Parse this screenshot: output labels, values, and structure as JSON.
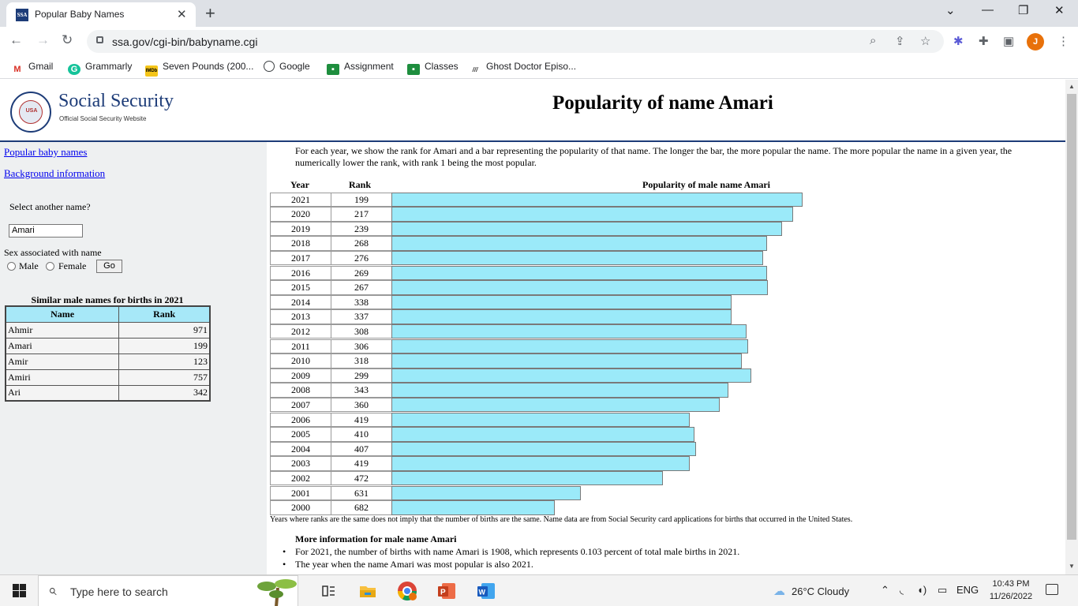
{
  "browser": {
    "tab_title": "Popular Baby Names",
    "tab_favicon": "SSA",
    "url": "ssa.gov/cgi-bin/babyname.cgi",
    "profile_initial": "J",
    "bookmarks": [
      {
        "label": "Gmail",
        "icon": "gmail-icon"
      },
      {
        "label": "Grammarly",
        "icon": "grammarly-icon"
      },
      {
        "label": "Seven Pounds (200...",
        "icon": "imdb-icon",
        "icon_text": "IMDb"
      },
      {
        "label": "Google",
        "icon": "google-icon"
      },
      {
        "label": "Assignment",
        "icon": "classroom-icon"
      },
      {
        "label": "Classes",
        "icon": "classroom-icon"
      },
      {
        "label": "Ghost Doctor Episo...",
        "icon": "site-icon"
      }
    ]
  },
  "header": {
    "seal_text": "USA",
    "logo_title": "Social Security",
    "logo_subtitle": "Official Social Security Website",
    "page_title": "Popularity of name Amari"
  },
  "sidebar": {
    "link_popular": "Popular baby names",
    "link_background": "Background information",
    "select_label": "Select another name?",
    "name_value": "Amari",
    "sex_label": "Sex associated with name",
    "male_label": "Male",
    "female_label": "Female",
    "go_label": "Go",
    "similar_title": "Similar male names for births in 2021",
    "similar_headers": [
      "Name",
      "Rank"
    ],
    "similar_rows": [
      {
        "name": "Ahmir",
        "rank": "971"
      },
      {
        "name": "Amari",
        "rank": "199"
      },
      {
        "name": "Amir",
        "rank": "123"
      },
      {
        "name": "Amiri",
        "rank": "757"
      },
      {
        "name": "Ari",
        "rank": "342"
      }
    ]
  },
  "main": {
    "intro": "For each year, we show the rank for Amari and a bar representing the popularity of that name. The longer the bar, the more popular the name. The more popular the name in a given year, the numerically lower the rank, with rank 1 being the most popular.",
    "col_year": "Year",
    "col_rank": "Rank",
    "col_bar": "Popularity of male name Amari",
    "footnote": "Years where ranks are the same does not imply that the number of births are the same. Name data are from Social Security card applications for births that occurred in the United States.",
    "more_title": "More information for male name Amari",
    "more_items": [
      "For 2021, the number of births with name Amari is 1908, which represents 0.103 percent of total male births in 2021.",
      "The year when the name Amari was most popular is also 2021."
    ]
  },
  "chart_data": {
    "type": "bar",
    "title": "Popularity of male name Amari",
    "orientation": "horizontal",
    "categories": [
      "2021",
      "2020",
      "2019",
      "2018",
      "2017",
      "2016",
      "2015",
      "2014",
      "2013",
      "2012",
      "2011",
      "2010",
      "2009",
      "2008",
      "2007",
      "2006",
      "2005",
      "2004",
      "2003",
      "2002",
      "2001",
      "2000"
    ],
    "ranks": [
      199,
      217,
      239,
      268,
      276,
      269,
      267,
      338,
      337,
      308,
      306,
      318,
      299,
      343,
      360,
      419,
      410,
      407,
      419,
      472,
      631,
      682
    ],
    "bar_color": "#9beaf9"
  },
  "taskbar": {
    "search_placeholder": "Type here to search",
    "weather": "26°C  Cloudy",
    "language": "ENG",
    "time": "10:43 PM",
    "date": "11/26/2022"
  }
}
